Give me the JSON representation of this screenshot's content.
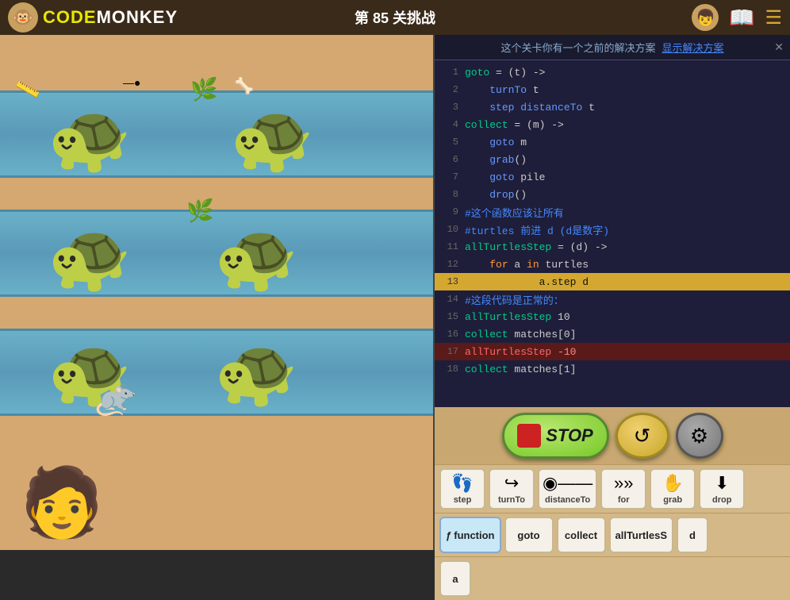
{
  "topbar": {
    "logo": "🐵",
    "logo_code": "CODE",
    "logo_monkey": "monkey",
    "title": "第 85 关挑战",
    "avatar": "👦",
    "book": "📖",
    "menu": "☰"
  },
  "notice": {
    "text": "这个关卡你有一个之前的解决方案",
    "link_text": "显示解决方案",
    "close": "✕"
  },
  "code_lines": [
    {
      "num": 1,
      "text": "goto = (t) ->",
      "type": "normal"
    },
    {
      "num": 2,
      "text": "    turnTo t",
      "type": "normal"
    },
    {
      "num": 3,
      "text": "    step distanceTo t",
      "type": "normal"
    },
    {
      "num": 4,
      "text": "collect = (m) ->",
      "type": "normal"
    },
    {
      "num": 5,
      "text": "    goto m",
      "type": "normal"
    },
    {
      "num": 6,
      "text": "    grab()",
      "type": "normal"
    },
    {
      "num": 7,
      "text": "    goto pile",
      "type": "normal"
    },
    {
      "num": 8,
      "text": "    drop()",
      "type": "normal"
    },
    {
      "num": 9,
      "text": "#这个函数应该让所有",
      "type": "comment"
    },
    {
      "num": 10,
      "text": "#turtles 前进 d (d是数字)",
      "type": "comment"
    },
    {
      "num": 11,
      "text": "allTurtlesStep = (d) ->",
      "type": "normal"
    },
    {
      "num": 12,
      "text": "    for a in turtles",
      "type": "normal"
    },
    {
      "num": 13,
      "text": "            a.step d",
      "type": "highlight"
    },
    {
      "num": 14,
      "text": "#这段代码是正常的：",
      "type": "comment"
    },
    {
      "num": 15,
      "text": "allTurtlesStep 10",
      "type": "normal"
    },
    {
      "num": 16,
      "text": "collect matches[0]",
      "type": "normal"
    },
    {
      "num": 17,
      "text": "allTurtlesStep -10",
      "type": "error"
    },
    {
      "num": 18,
      "text": "collect matches[1]",
      "type": "normal"
    }
  ],
  "controls": {
    "stop_label": "STOP",
    "refresh_icon": "↺",
    "gear_icon": "⚙"
  },
  "toolbar1": [
    {
      "icon": "👣",
      "label": "step"
    },
    {
      "icon": "↪",
      "label": "turnTo"
    },
    {
      "icon": "⊸",
      "label": "distanceTo"
    },
    {
      "icon": "»»",
      "label": "for"
    },
    {
      "icon": "✋",
      "label": "grab"
    },
    {
      "icon": "↓↓",
      "label": "drop"
    }
  ],
  "toolbar2": [
    {
      "label": "function",
      "wide": true
    },
    {
      "label": "goto"
    },
    {
      "label": "collect"
    },
    {
      "label": "allTurtlesS"
    },
    {
      "label": "d"
    }
  ],
  "toolbar3": [
    {
      "label": "a"
    }
  ]
}
